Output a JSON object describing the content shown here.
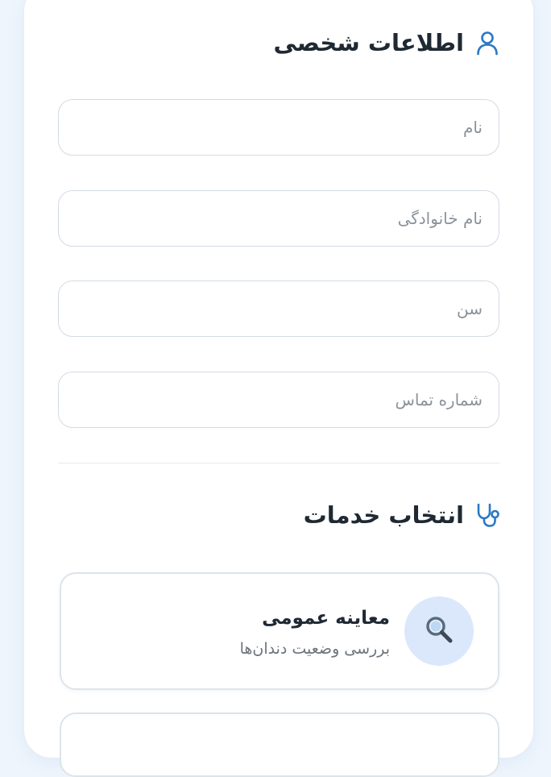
{
  "personal_info": {
    "title": "اطلاعات شخصی",
    "icon": "user-icon",
    "fields": [
      {
        "placeholder": "نام",
        "value": ""
      },
      {
        "placeholder": "نام خانوادگی",
        "value": ""
      },
      {
        "placeholder": "سن",
        "value": ""
      },
      {
        "placeholder": "شماره تماس",
        "value": ""
      }
    ]
  },
  "services": {
    "title": "انتخاب خدمات",
    "icon": "stethoscope-icon",
    "items": [
      {
        "name": "معاینه عمومی",
        "description": "بررسی وضعیت دندان‌ها",
        "icon": "magnifier-icon"
      }
    ]
  },
  "colors": {
    "accent": "#2b78c5",
    "background": "#eef5fd",
    "icon_circle": "#dbe8fb"
  }
}
